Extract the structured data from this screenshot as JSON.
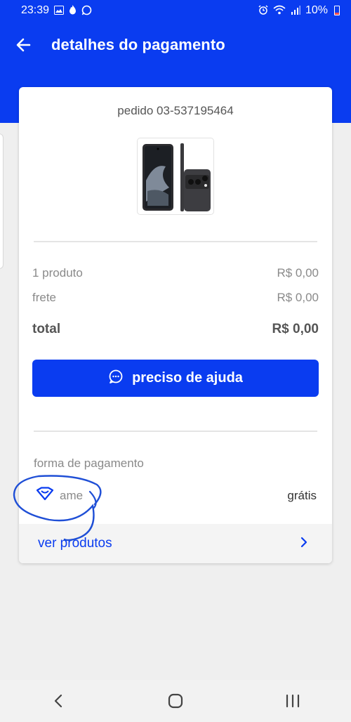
{
  "status_bar": {
    "time": "23:39",
    "battery": "10%"
  },
  "header": {
    "title": "detalhes do pagamento",
    "background_color": "#0a3cf0"
  },
  "order": {
    "id_label": "pedido 03-537195464"
  },
  "summary": {
    "rows": [
      {
        "label": "1 produto",
        "value": "R$ 0,00"
      },
      {
        "label": "frete",
        "value": "R$ 0,00"
      }
    ],
    "total_label": "total",
    "total_value": "R$ 0,00"
  },
  "help_button": {
    "label": "preciso de ajuda",
    "icon": "chat-bubble-icon"
  },
  "payment": {
    "section_title": "forma de pagamento",
    "method_label": "ame",
    "method_icon": "ame-heart-icon",
    "price_label": "grátis"
  },
  "footer_link": {
    "label": "ver produtos"
  },
  "accent_color": "#0a3cf0"
}
